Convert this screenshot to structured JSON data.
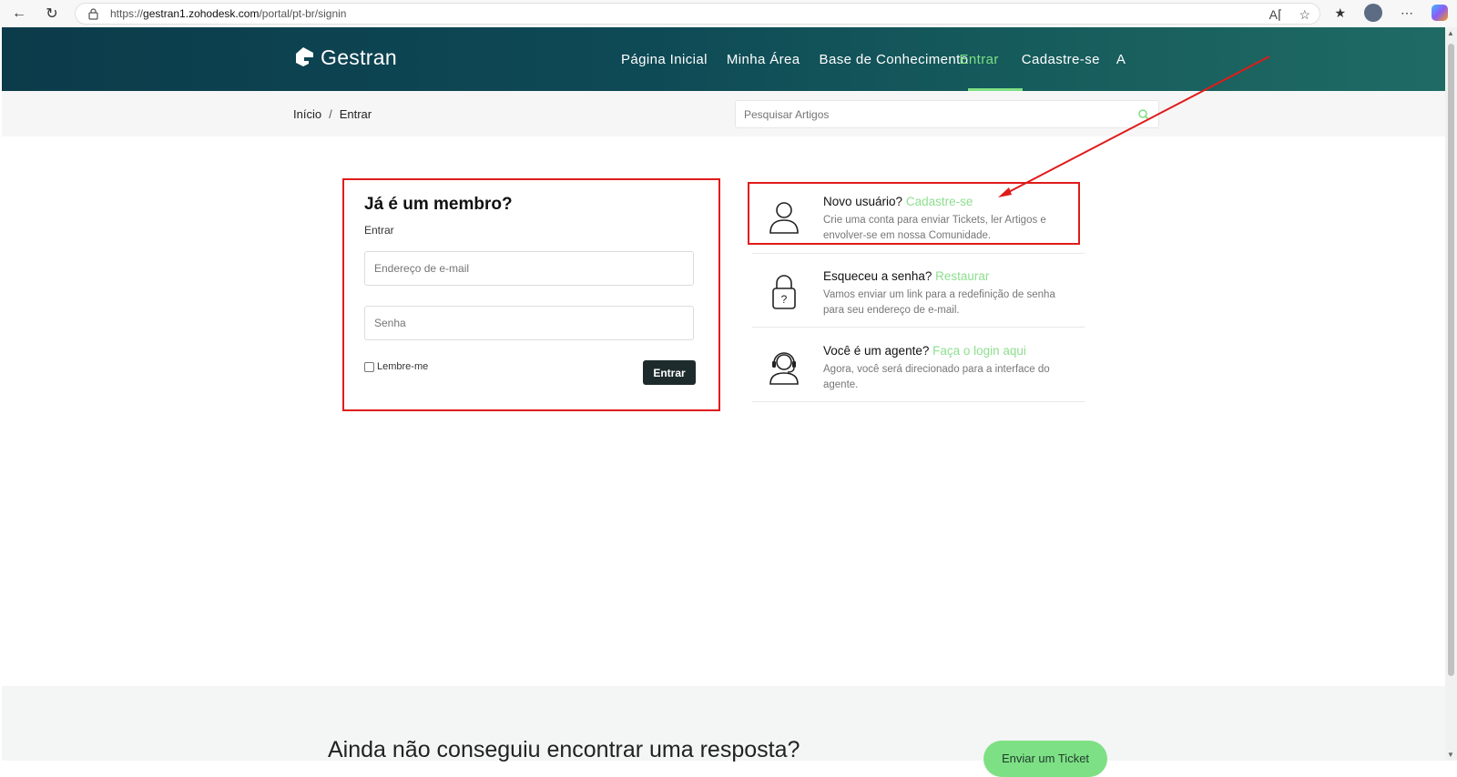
{
  "browser": {
    "url_prefix": "https://",
    "url_host": "gestran1.zohodesk.com",
    "url_path": "/portal/pt-br/signin"
  },
  "header": {
    "logo_text": "Gestran",
    "nav": [
      "Página Inicial",
      "Minha Área",
      "Base de Conhecimento",
      "Entrar",
      "Cadastre-se",
      "A"
    ]
  },
  "breadcrumb": {
    "home": "Início",
    "sep": "/",
    "current": "Entrar"
  },
  "search": {
    "placeholder": "Pesquisar Artigos"
  },
  "login": {
    "title": "Já é um membro?",
    "subtitle": "Entrar",
    "email_placeholder": "Endereço de e-mail",
    "password_placeholder": "Senha",
    "remember_label": "Lembre-me",
    "submit_label": "Entrar"
  },
  "info": {
    "new_user_title": "Novo usuário?",
    "new_user_link": "Cadastre-se",
    "new_user_desc": "Crie uma conta para enviar Tickets, ler Artigos e envolver-se em nossa Comunidade.",
    "forgot_title": "Esqueceu a senha?",
    "forgot_link": "Restaurar",
    "forgot_desc": "Vamos enviar um link para a redefinição de senha para seu endereço de e-mail.",
    "agent_title": "Você é um agente?",
    "agent_link": "Faça o login aqui",
    "agent_desc": "Agora, você será direcionado para a interface do agente."
  },
  "footer": {
    "question": "Ainda não conseguiu encontrar uma resposta?",
    "ticket_button": "Enviar um Ticket"
  },
  "colors": {
    "header_bg": "#0c3b4a",
    "accent": "#7ee084",
    "annotation": "#e01b1b"
  }
}
